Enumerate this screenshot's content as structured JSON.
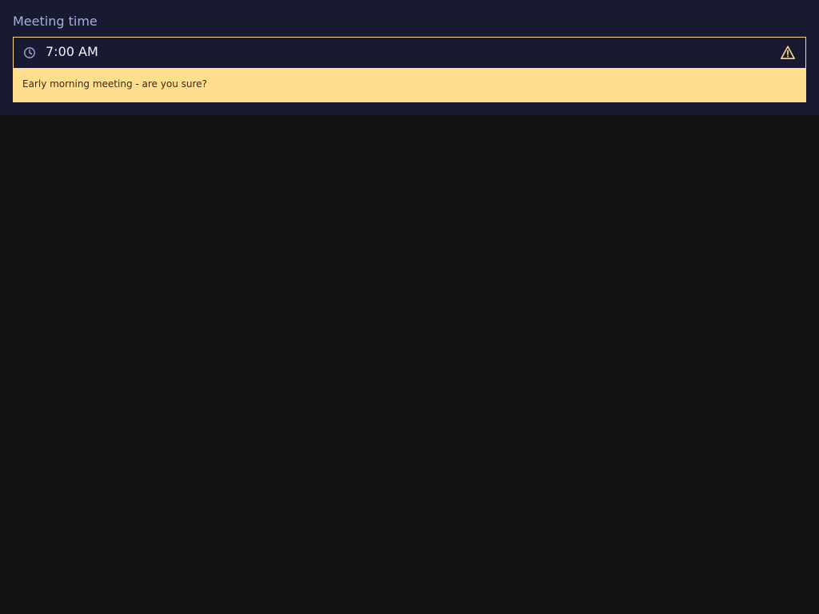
{
  "field": {
    "label": "Meeting time",
    "value": "7:00 AM",
    "warning": "Early morning meeting - are you sure?"
  },
  "icons": {
    "leading": "clock-icon",
    "trailing": "warning-triangle-icon"
  },
  "colors": {
    "panel_background": "#171a31",
    "page_background": "#131313",
    "label": "#a9aee0",
    "value": "#f2f3fb",
    "warning_accent": "#ffd98a",
    "warning_background": "#ffdf8d",
    "warning_text": "#3b2a0c"
  }
}
